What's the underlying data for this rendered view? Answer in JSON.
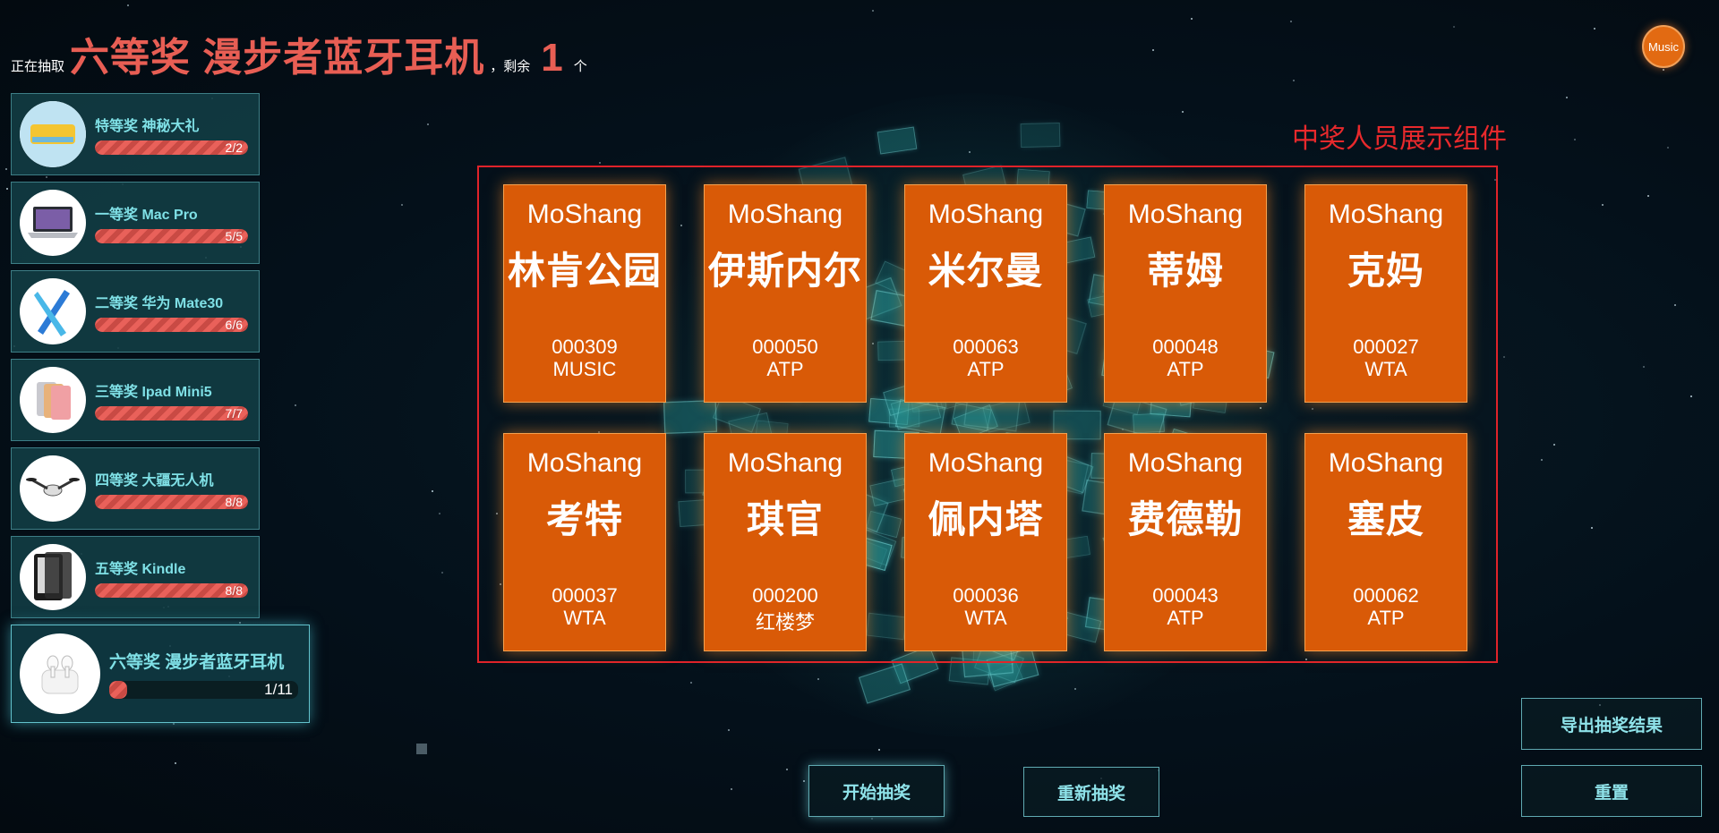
{
  "header": {
    "drawing_label": "正在抽取",
    "current_prize": "六等奖 漫步者蓝牙耳机",
    "remaining_label": "，剩余",
    "remaining_count": "1",
    "unit": "个"
  },
  "music_button": {
    "label": "Music"
  },
  "annotation": "中奖人员展示组件",
  "prizes": [
    {
      "title": "特等奖 神秘大礼",
      "progress_text": "2/2",
      "progress": 1.0,
      "icon": "mystery-gift-icon"
    },
    {
      "title": "一等奖 Mac Pro",
      "progress_text": "5/5",
      "progress": 1.0,
      "icon": "laptop-icon"
    },
    {
      "title": "二等奖 华为 Mate30",
      "progress_text": "6/6",
      "progress": 1.0,
      "icon": "phone-icon"
    },
    {
      "title": "三等奖 Ipad Mini5",
      "progress_text": "7/7",
      "progress": 1.0,
      "icon": "tablet-icon"
    },
    {
      "title": "四等奖 大疆无人机",
      "progress_text": "8/8",
      "progress": 1.0,
      "icon": "drone-icon"
    },
    {
      "title": "五等奖 Kindle",
      "progress_text": "8/8",
      "progress": 1.0,
      "icon": "ereader-icon"
    },
    {
      "title": "六等奖 漫步者蓝牙耳机",
      "progress_text": "1/11",
      "progress": 0.09,
      "icon": "earbuds-icon"
    }
  ],
  "winners": [
    {
      "company": "MoShang",
      "name": "林肯公园",
      "id": "000309",
      "dept": "MUSIC"
    },
    {
      "company": "MoShang",
      "name": "伊斯内尔",
      "id": "000050",
      "dept": "ATP"
    },
    {
      "company": "MoShang",
      "name": "米尔曼",
      "id": "000063",
      "dept": "ATP"
    },
    {
      "company": "MoShang",
      "name": "蒂姆",
      "id": "000048",
      "dept": "ATP"
    },
    {
      "company": "MoShang",
      "name": "克妈",
      "id": "000027",
      "dept": "WTA"
    },
    {
      "company": "MoShang",
      "name": "考特",
      "id": "000037",
      "dept": "WTA"
    },
    {
      "company": "MoShang",
      "name": "琪官",
      "id": "000200",
      "dept": "红楼梦"
    },
    {
      "company": "MoShang",
      "name": "佩内塔",
      "id": "000036",
      "dept": "WTA"
    },
    {
      "company": "MoShang",
      "name": "费德勒",
      "id": "000043",
      "dept": "ATP"
    },
    {
      "company": "MoShang",
      "name": "塞皮",
      "id": "000062",
      "dept": "ATP"
    }
  ],
  "buttons": {
    "start": "开始抽奖",
    "redraw": "重新抽奖",
    "export": "导出抽奖结果",
    "reset": "重置"
  },
  "colors": {
    "accent": "#e85e54",
    "card": "#d95a07",
    "teal": "#7fe0e6",
    "annotation": "#e8292c"
  }
}
